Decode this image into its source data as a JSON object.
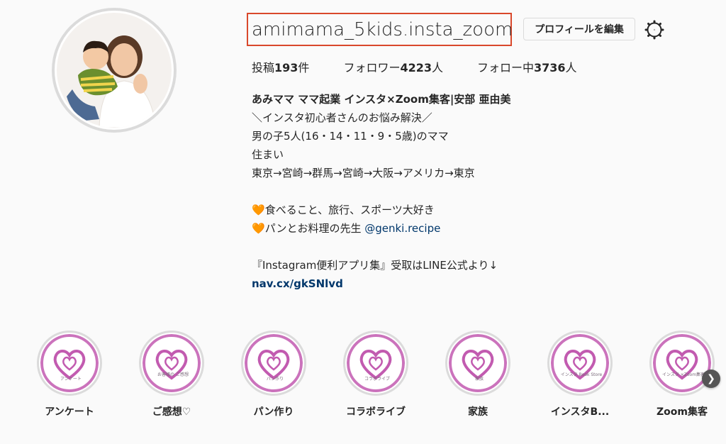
{
  "profile": {
    "username": "amimama_5kids.insta_zoom",
    "edit_label": "プロフィールを編集"
  },
  "stats": {
    "posts_prefix": "投稿",
    "posts": "193",
    "posts_suffix": "件",
    "followers_prefix": "フォロワー",
    "followers": "4223",
    "followers_suffix": "人",
    "following_prefix": "フォロー中",
    "following": "3736",
    "following_suffix": "人"
  },
  "bio": {
    "name": "あみママ ママ起業 インスタ×Zoom集客|安部 亜由美",
    "line1": "＼インスタ初心者さんのお悩み解決／",
    "line2": "男の子5人(16・14・11・9・5歳)のママ",
    "line3": "住まい",
    "line4": "東京→宮崎→群馬→宮崎→大阪→アメリカ→東京",
    "heart": "🧡",
    "line5": "食べること、旅行、スポーツ大好き",
    "line6": "パンとお料理の先生 ",
    "mention": "@genki.recipe",
    "line7": "『Instagram便利アプリ集』受取はLINE公式より↓",
    "link": "nav.cx/gkSNlvd"
  },
  "highlights": [
    {
      "label": "アンケート",
      "caption": "アンケート"
    },
    {
      "label": "ご感想♡",
      "caption": "お客様の ご感想"
    },
    {
      "label": "パン作り",
      "caption": "パン作り"
    },
    {
      "label": "コラボライブ",
      "caption": "コラボライブ"
    },
    {
      "label": "家族",
      "caption": "家族"
    },
    {
      "label": "インスタB...",
      "caption": "インスタ Book Store"
    },
    {
      "label": "Zoom集客",
      "caption": "インスタ ×Zoom集客"
    }
  ],
  "colors": {
    "highlight_heart": "#c25bb0",
    "username_outline": "#d9482b",
    "link": "#00376b"
  }
}
